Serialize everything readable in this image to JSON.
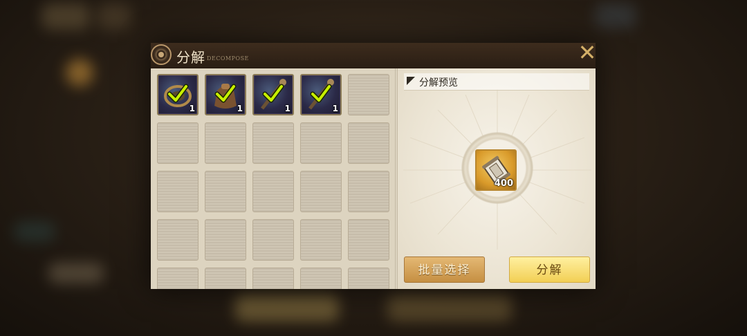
{
  "dialog": {
    "title": "分解",
    "subtitle": "DECOMPOSE",
    "close_symbol": "✕"
  },
  "inventory": {
    "slots": [
      {
        "filled": true,
        "selected": true,
        "quantity": "1",
        "icon": "shield-ring-icon"
      },
      {
        "filled": true,
        "selected": true,
        "quantity": "1",
        "icon": "pouch-icon"
      },
      {
        "filled": true,
        "selected": true,
        "quantity": "1",
        "icon": "staff-icon"
      },
      {
        "filled": true,
        "selected": true,
        "quantity": "1",
        "icon": "staff-icon"
      },
      {
        "filled": false
      }
    ],
    "empty_slot_count": 20
  },
  "preview": {
    "title": "分解预览",
    "result": {
      "quantity": "400",
      "icon": "scroll-capsule-icon"
    }
  },
  "buttons": {
    "batch_select": "批量选择",
    "decompose": "分解"
  },
  "colors": {
    "check": "#c8f000",
    "gold_border": "#b8862e",
    "title_text": "#efe2c8"
  }
}
